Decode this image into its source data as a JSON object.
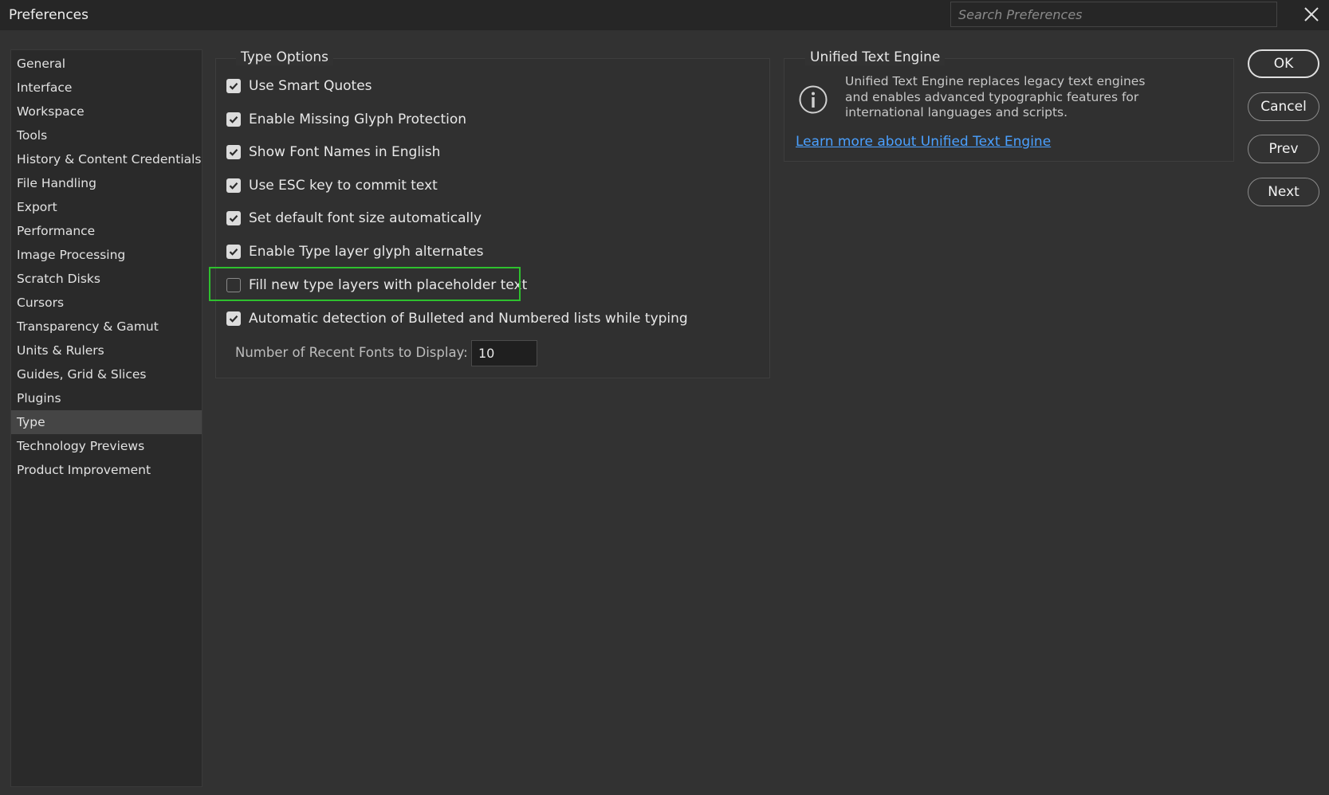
{
  "window": {
    "title": "Preferences",
    "search_placeholder": "Search Preferences"
  },
  "sidebar": {
    "items": [
      {
        "label": "General"
      },
      {
        "label": "Interface"
      },
      {
        "label": "Workspace"
      },
      {
        "label": "Tools"
      },
      {
        "label": "History & Content Credentials"
      },
      {
        "label": "File Handling"
      },
      {
        "label": "Export"
      },
      {
        "label": "Performance"
      },
      {
        "label": "Image Processing"
      },
      {
        "label": "Scratch Disks"
      },
      {
        "label": "Cursors"
      },
      {
        "label": "Transparency & Gamut"
      },
      {
        "label": "Units & Rulers"
      },
      {
        "label": "Guides, Grid & Slices"
      },
      {
        "label": "Plugins"
      },
      {
        "label": "Type",
        "selected": true
      },
      {
        "label": "Technology Previews"
      },
      {
        "label": "Product Improvement"
      }
    ]
  },
  "type_options": {
    "title": "Type Options",
    "options": [
      {
        "label": "Use Smart Quotes",
        "checked": true
      },
      {
        "label": "Enable Missing Glyph Protection",
        "checked": true
      },
      {
        "label": "Show Font Names in English",
        "checked": true
      },
      {
        "label": "Use ESC key to commit text",
        "checked": true
      },
      {
        "label": "Set default font size automatically",
        "checked": true
      },
      {
        "label": "Enable Type layer glyph alternates",
        "checked": true
      },
      {
        "label": "Fill new type layers with placeholder text",
        "checked": false
      },
      {
        "label": "Automatic detection of Bulleted and Numbered lists while typing",
        "checked": true
      }
    ],
    "recent_fonts_label": "Number of Recent Fonts to Display:",
    "recent_fonts_value": "10"
  },
  "unified_text_engine": {
    "title": "Unified Text Engine",
    "description": "Unified Text Engine replaces legacy text engines and enables advanced typographic features for international languages and scripts.",
    "link": "Learn more about Unified Text Engine"
  },
  "buttons": {
    "ok": "OK",
    "cancel": "Cancel",
    "prev": "Prev",
    "next": "Next"
  },
  "colors": {
    "background": "#323232",
    "highlight": "#2ec02e",
    "link": "#4aa0ff"
  }
}
